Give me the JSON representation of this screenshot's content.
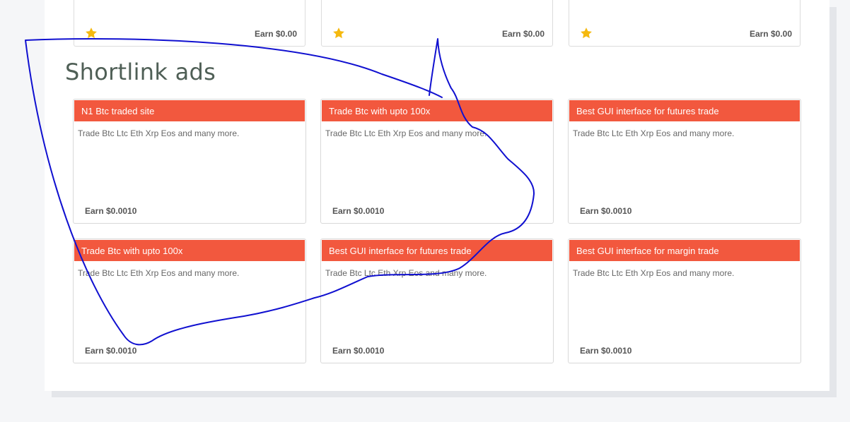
{
  "top_cards": [
    {
      "earn": "Earn $0.00",
      "icon": "star-icon"
    },
    {
      "earn": "Earn $0.00",
      "icon": "star-icon"
    },
    {
      "earn": "Earn $0.00",
      "icon": "star-icon"
    }
  ],
  "section_title": "Shortlink ads",
  "ads": [
    {
      "title": "N1 Btc traded site",
      "description": "Trade Btc Ltc Eth Xrp Eos and many more.",
      "earn": "Earn $0.0010"
    },
    {
      "title": "Trade Btc with upto 100x",
      "description": "Trade Btc Ltc Eth Xrp Eos and many more.",
      "earn": "Earn $0.0010"
    },
    {
      "title": "Best GUI interface for futures trade",
      "description": "Trade Btc Ltc Eth Xrp Eos and many more.",
      "earn": "Earn $0.0010"
    },
    {
      "title": "Trade Btc with upto 100x",
      "description": "Trade Btc Ltc Eth Xrp Eos and many more.",
      "earn": "Earn $0.0010"
    },
    {
      "title": "Best GUI interface for futures trade",
      "description": "Trade Btc Ltc Eth Xrp Eos and many more.",
      "earn": "Earn $0.0010"
    },
    {
      "title": "Best GUI interface for margin trade",
      "description": "Trade Btc Ltc Eth Xrp Eos and many more.",
      "earn": "Earn $0.0010"
    }
  ],
  "colors": {
    "ad_header": "#f2583e",
    "star": "#f5b90f",
    "annotation_stroke": "#1010d0"
  }
}
